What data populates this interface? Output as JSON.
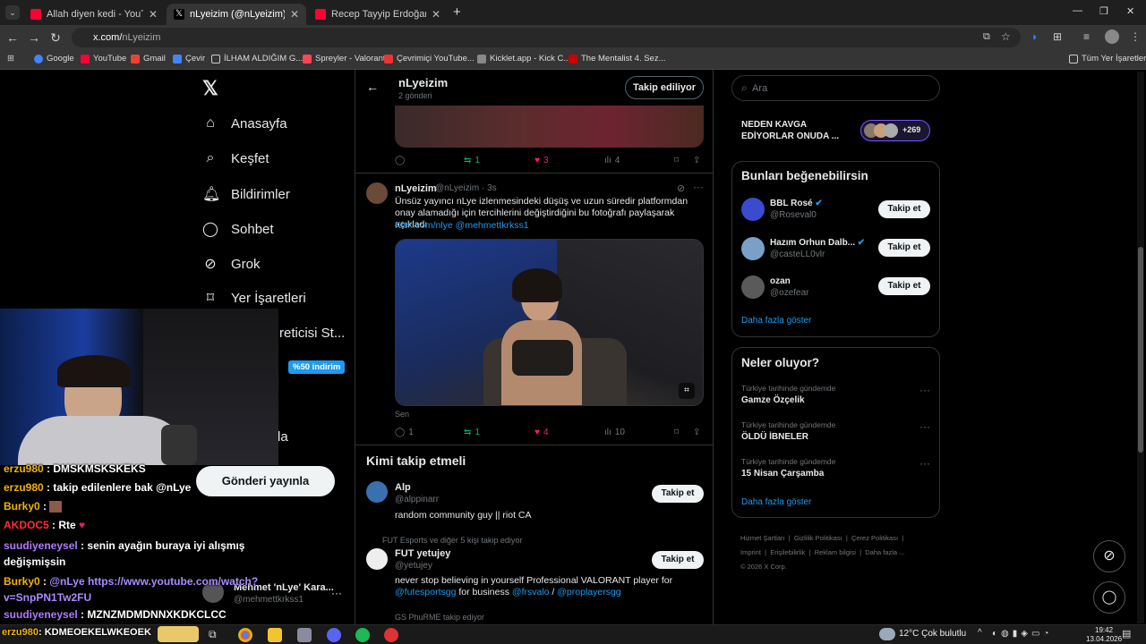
{
  "browser": {
    "tabs": [
      {
        "title": "Allah diyen kedi - YouTube",
        "color": "#ff0033"
      },
      {
        "title": "nLyeizim (@nLyeizim) / X",
        "color": "#ffffff"
      },
      {
        "title": "Recep Tayyip Erdoğan Reis edi",
        "color": "#ff0033"
      }
    ],
    "new_tab": "+",
    "url_host": "x.com/",
    "url_path": "nLyeizim",
    "bookmarks": [
      "Google",
      "YouTube",
      "Gmail",
      "Çevir",
      "İLHAM ALDIĞIM G...",
      "Spreyler - Valorant",
      "Çevrimiçi YouTube...",
      "Kicklet.app - Kick C...",
      "The Mentalist 4. Sez..."
    ],
    "bookmarks_right": "Tüm Yer İşaretleri"
  },
  "nav": {
    "items": [
      "Anasayfa",
      "Keşfet",
      "Bildirimler",
      "Sohbet",
      "Grok",
      "Yer İşaretleri"
    ],
    "partial_item": "reticisi St...",
    "discount_badge": "%50 indirim",
    "partial_more": "la",
    "post_button": "Gönderi yayınla"
  },
  "profile_header": {
    "name": "nLyeizim",
    "posts": "2 gönderi",
    "follow_label": "Takip ediliyor"
  },
  "post1_actions": {
    "replies": "",
    "reposts": "1",
    "likes": "3",
    "views": "4"
  },
  "post2": {
    "name": "nLyeizim",
    "handle": "@nLyeizim · 3s",
    "text": "Ünsüz yayıncı nLye izlenmesindeki düşüş ve uzun süredir platformdan onay alamadığı için tercihlerini değiştirdiğini bu fotoğrafı paylaşarak açıkladı",
    "link": "Kick.com/nlye @mehmettkrkss1",
    "tag": "Sen",
    "replies": "1",
    "reposts": "1",
    "likes": "4",
    "views": "10"
  },
  "who_to_follow": {
    "title": "Kimi takip etmeli",
    "users": [
      {
        "name": "Alp",
        "handle": "@alppinarr",
        "bio": "random community guy || riot CA",
        "context": ""
      },
      {
        "name": "FUT yetujey",
        "handle": "@yetujey",
        "bio_pre": "never stop believing in yourself Professional VALORANT player for ",
        "bio_link1": "@futesportsgg",
        "bio_mid": " for business ",
        "bio_link2": "@frsvalo",
        "bio_sep": " / ",
        "bio_link3": "@proplayersgg",
        "context": "FUT Esports ve diğer 5 kişi takip ediyor"
      }
    ],
    "follow_label": "Takip et",
    "more_context": "GS PhuRME takip ediyor"
  },
  "account_switcher": {
    "name": "Mehmet 'nLye' Kara...",
    "handle": "@mehmettkrkss1"
  },
  "right": {
    "search_placeholder": "Ara",
    "space_title": "NEDEN KAVGA EDİYORLAR ONUDA ...",
    "space_count": "+269",
    "suggest_title": "Bunları beğenebilirsin",
    "suggestions": [
      {
        "name": "BBL Rosé",
        "handle": "@Roseval0",
        "color": "#3b4bd0"
      },
      {
        "name": "Hazım Orhun Dalb...",
        "handle": "@casteLL0vlr",
        "color": "#7aa0c8"
      },
      {
        "name": "ozan",
        "handle": "@ozefear",
        "color": "#5a5a5a"
      }
    ],
    "follow_label": "Takip et",
    "show_more": "Daha fazla göster",
    "trends_title": "Neler oluyor?",
    "trends": [
      {
        "context": "Türkiye tarihinde gündemde",
        "title": "Gamze Özçelik"
      },
      {
        "context": "Türkiye tarihinde gündemde",
        "title": "ÖLDÜ İBNELER"
      },
      {
        "context": "Türkiye tarihinde gündemde",
        "title": "15 Nisan Çarşamba"
      }
    ],
    "footer": [
      "Hizmet Şartları",
      "Gizlilik Politikası",
      "Çerez Politikası",
      "Imprint",
      "Erişilebilirlik",
      "Reklam bilgisi",
      "Daha fazla ..."
    ],
    "copyright": "© 2026 X Corp."
  },
  "chat": [
    {
      "user": "erzu980",
      "msg": "DMSKMSKSKEKS",
      "color": "#ffffff"
    },
    {
      "user": "erzu980",
      "msg": "takip edilenlere bak @nLye",
      "color": "#ffffff"
    },
    {
      "user": "Burky0",
      "msg": "",
      "color": "#f0b400"
    },
    {
      "user": "AKDOC5",
      "msg": "Rte",
      "color": "#ff3030"
    },
    {
      "user": "suudiyeneysel",
      "msg": "senin ayağın buraya iyi alışmış değişmişsin",
      "color": "#b07aff"
    },
    {
      "user": "Burky0",
      "msg": "@nLye https://www.youtube.com/watch?v=SnpPN1Tw2FU",
      "color": "#f0b400"
    },
    {
      "user": "suudiyeneysel",
      "msg": "MZNZMDMDNNXKDKCLCC",
      "color": "#b07aff"
    },
    {
      "user": "erzu980",
      "msg": "KDMEOEKELWKEOEK",
      "color": "#ffffff"
    }
  ],
  "taskbar": {
    "weather": "12°C  Çok bulutlu",
    "time": "19:42",
    "date": "13.04.2026"
  }
}
